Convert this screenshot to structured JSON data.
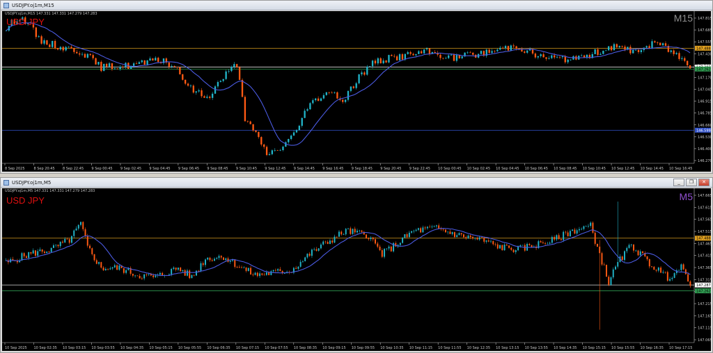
{
  "windows": [
    {
      "id": "m15",
      "title": "USDJPY.oj1m,M15",
      "info_line": "USDJPY.oj1m,M15  147.331 147.331 147.279 147.283",
      "symbol_label": "USD JPY",
      "timeframe_label": "M15",
      "timeframe_color": "#8f8f8f",
      "controls": [],
      "price_ticks": [
        "147.815",
        "147.685",
        "147.555",
        "147.430",
        "147.300",
        "147.170",
        "147.045",
        "146.915",
        "146.785",
        "146.660",
        "146.530",
        "146.400",
        "146.270"
      ],
      "time_ticks": [
        "8 Sep 2025",
        "8 Sep 20:45",
        "8 Sep 22:45",
        "9 Sep 00:45",
        "9 Sep 02:45",
        "9 Sep 04:45",
        "9 Sep 06:45",
        "9 Sep 08:45",
        "9 Sep 10:45",
        "9 Sep 12:45",
        "9 Sep 14:45",
        "9 Sep 16:45",
        "9 Sep 18:45",
        "9 Sep 20:45",
        "9 Sep 22:45",
        "10 Sep 00:45",
        "10 Sep 02:45",
        "10 Sep 04:45",
        "10 Sep 06:45",
        "10 Sep 08:45",
        "10 Sep 10:45",
        "10 Sep 12:45",
        "10 Sep 14:45",
        "10 Sep 16:45"
      ],
      "price_tags": [
        {
          "price": "147.488",
          "value": 147.488,
          "bg": "#e0a020",
          "line": "#d69a1c",
          "fg": "#000"
        },
        {
          "price": "147.283",
          "value": 147.283,
          "bg": "#ffffff",
          "line": "#d8d8d8",
          "fg": "#000"
        },
        {
          "price": "147.262",
          "value": 147.262,
          "bg": "#2f9a50",
          "line": "#2f9a50",
          "fg": "#000"
        },
        {
          "price": "146.599",
          "value": 146.599,
          "bg": "#3050c8",
          "line": "#3050c8",
          "fg": "#fff"
        }
      ],
      "range": [
        146.24,
        147.86
      ],
      "seed": 15,
      "waypoints": [
        [
          0,
          147.7
        ],
        [
          4,
          147.82
        ],
        [
          8,
          147.78
        ],
        [
          12,
          147.58
        ],
        [
          20,
          147.5
        ],
        [
          28,
          147.45
        ],
        [
          35,
          147.28
        ],
        [
          45,
          147.3
        ],
        [
          58,
          147.36
        ],
        [
          62,
          147.28
        ],
        [
          68,
          147.05
        ],
        [
          74,
          146.95
        ],
        [
          80,
          147.18
        ],
        [
          85,
          147.32
        ],
        [
          88,
          146.72
        ],
        [
          92,
          146.55
        ],
        [
          96,
          146.35
        ],
        [
          100,
          146.38
        ],
        [
          106,
          146.55
        ],
        [
          112,
          146.88
        ],
        [
          118,
          147.02
        ],
        [
          124,
          146.92
        ],
        [
          130,
          147.18
        ],
        [
          136,
          147.35
        ],
        [
          145,
          147.4
        ],
        [
          155,
          147.45
        ],
        [
          165,
          147.38
        ],
        [
          178,
          147.45
        ],
        [
          188,
          147.52
        ],
        [
          196,
          147.4
        ],
        [
          210,
          147.36
        ],
        [
          222,
          147.5
        ],
        [
          232,
          147.46
        ],
        [
          240,
          147.55
        ],
        [
          246,
          147.44
        ],
        [
          252,
          147.3
        ]
      ],
      "candles": 253,
      "ma_color": "#4a5ae0",
      "up_color": "#21b4c8",
      "down_color": "#ff5a14"
    },
    {
      "id": "m5",
      "title": "USDJPY.oj1m,M5",
      "info_line": "USDJPY.oj1m,M5  147.331 147.331 147.279 147.283",
      "symbol_label": "USD JPY",
      "timeframe_label": "M5",
      "timeframe_color": "#9050d0",
      "controls": [
        "_",
        "❐",
        "✕"
      ],
      "price_ticks": [
        "147.665",
        "147.615",
        "147.565",
        "147.515",
        "147.465",
        "147.415",
        "147.365",
        "147.315",
        "147.265",
        "147.215",
        "147.165",
        "147.115",
        "147.065"
      ],
      "time_ticks": [
        "10 Sep 2025",
        "10 Sep 02:35",
        "10 Sep 03:15",
        "10 Sep 03:55",
        "10 Sep 04:35",
        "10 Sep 05:15",
        "10 Sep 05:55",
        "10 Sep 06:35",
        "10 Sep 07:15",
        "10 Sep 07:55",
        "10 Sep 08:35",
        "10 Sep 09:15",
        "10 Sep 09:55",
        "10 Sep 10:35",
        "10 Sep 11:15",
        "10 Sep 11:55",
        "10 Sep 12:35",
        "10 Sep 13:15",
        "10 Sep 13:55",
        "10 Sep 14:35",
        "10 Sep 15:15",
        "10 Sep 15:55",
        "10 Sep 16:35",
        "10 Sep 17:15"
      ],
      "price_tags": [
        {
          "price": "147.488",
          "value": 147.488,
          "bg": "#e0a020",
          "line": "#d69a1c",
          "fg": "#000"
        },
        {
          "price": "147.287",
          "value": 147.287,
          "bg": "#ffffff",
          "line": "#d8d8d8",
          "fg": "#000"
        },
        {
          "price": "147.262",
          "value": 147.262,
          "bg": "#2f9a50",
          "line": "#2f9a50",
          "fg": "#000"
        }
      ],
      "range": [
        147.04,
        147.69
      ],
      "seed": 5,
      "waypoints": [
        [
          0,
          147.38
        ],
        [
          10,
          147.42
        ],
        [
          20,
          147.44
        ],
        [
          28,
          147.48
        ],
        [
          33,
          147.55
        ],
        [
          36,
          147.45
        ],
        [
          42,
          147.36
        ],
        [
          50,
          147.36
        ],
        [
          58,
          147.33
        ],
        [
          66,
          147.32
        ],
        [
          76,
          147.36
        ],
        [
          82,
          147.32
        ],
        [
          88,
          147.4
        ],
        [
          96,
          147.41
        ],
        [
          104,
          147.36
        ],
        [
          110,
          147.33
        ],
        [
          118,
          147.34
        ],
        [
          126,
          147.35
        ],
        [
          134,
          147.42
        ],
        [
          140,
          147.46
        ],
        [
          150,
          147.52
        ],
        [
          160,
          147.5
        ],
        [
          166,
          147.42
        ],
        [
          172,
          147.46
        ],
        [
          180,
          147.52
        ],
        [
          190,
          147.53
        ],
        [
          200,
          147.5
        ],
        [
          210,
          147.48
        ],
        [
          218,
          147.45
        ],
        [
          226,
          147.44
        ],
        [
          234,
          147.46
        ],
        [
          242,
          147.48
        ],
        [
          250,
          147.52
        ],
        [
          258,
          147.54
        ],
        [
          262,
          147.42
        ],
        [
          266,
          147.3
        ],
        [
          270,
          147.38
        ],
        [
          276,
          147.46
        ],
        [
          284,
          147.38
        ],
        [
          292,
          147.32
        ],
        [
          298,
          147.36
        ],
        [
          302,
          147.3
        ]
      ],
      "spikes": [
        {
          "i": 262,
          "low": 147.095,
          "high": 147.48
        },
        {
          "i": 270,
          "low": 147.36,
          "high": 147.645
        }
      ],
      "candles": 303,
      "ma_color": "#4a5ae0",
      "up_color": "#21b4c8",
      "down_color": "#ff5a14"
    }
  ]
}
